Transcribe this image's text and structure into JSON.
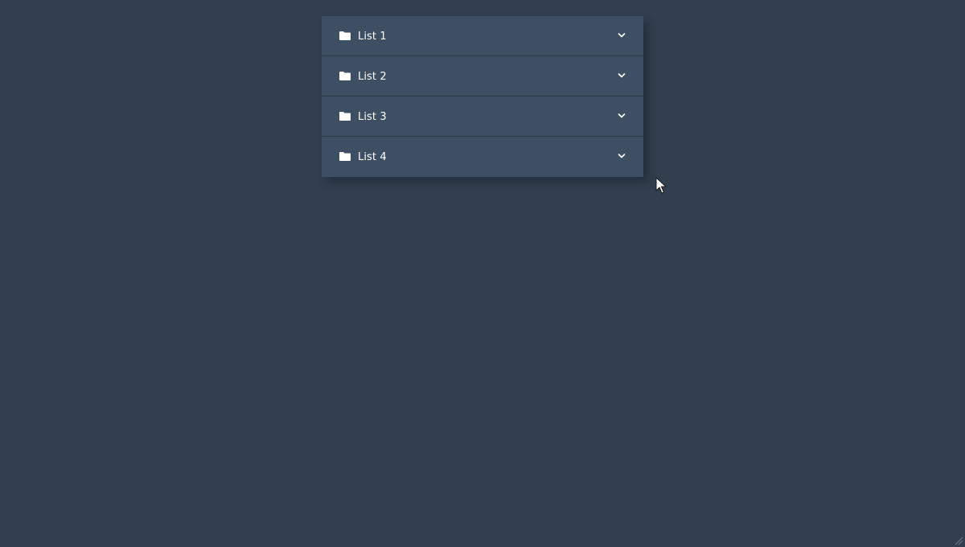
{
  "accordion": {
    "items": [
      {
        "label": "List 1",
        "icon": "folder-icon",
        "expand_icon": "chevron-down-icon"
      },
      {
        "label": "List 2",
        "icon": "folder-icon",
        "expand_icon": "chevron-down-icon"
      },
      {
        "label": "List 3",
        "icon": "folder-icon",
        "expand_icon": "chevron-down-icon"
      },
      {
        "label": "List 4",
        "icon": "folder-icon",
        "expand_icon": "chevron-down-icon"
      }
    ]
  },
  "colors": {
    "background": "#323f4f",
    "panel": "#3e4f63",
    "divider": "#2c3947",
    "text": "#ffffff"
  }
}
